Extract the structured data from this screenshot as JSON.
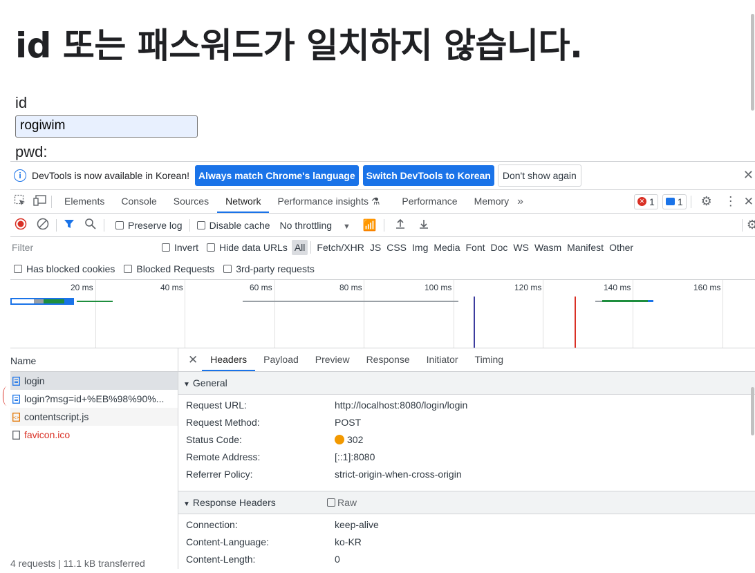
{
  "page": {
    "heading": "id 또는 패스워드가 일치하지 않습니다.",
    "id_label": "id",
    "id_value": "rogiwim",
    "pwd_label": "pwd:"
  },
  "infobar": {
    "message": "DevTools is now available in Korean!",
    "btn_match": "Always match Chrome's language",
    "btn_switch": "Switch DevTools to Korean",
    "btn_dont": "Don't show again"
  },
  "tabs": [
    "Elements",
    "Console",
    "Sources",
    "Network",
    "Performance insights",
    "Performance",
    "Memory"
  ],
  "active_tab": "Network",
  "badges": {
    "errors": "1",
    "messages": "1"
  },
  "toolbar": {
    "preserve_log": "Preserve log",
    "disable_cache": "Disable cache",
    "throttling": "No throttling"
  },
  "filter": {
    "placeholder": "Filter",
    "invert": "Invert",
    "hide_data_urls": "Hide data URLs",
    "types": [
      "All",
      "Fetch/XHR",
      "JS",
      "CSS",
      "Img",
      "Media",
      "Font",
      "Doc",
      "WS",
      "Wasm",
      "Manifest",
      "Other"
    ],
    "selected_type": "All"
  },
  "blocked": {
    "has_blocked_cookies": "Has blocked cookies",
    "blocked_requests": "Blocked Requests",
    "third_party": "3rd-party requests"
  },
  "timeline": {
    "ticks": [
      "20 ms",
      "40 ms",
      "60 ms",
      "80 ms",
      "100 ms",
      "120 ms",
      "140 ms",
      "160 ms"
    ]
  },
  "requests": {
    "header": "Name",
    "items": [
      {
        "name": "login",
        "type": "doc",
        "color": "#303942"
      },
      {
        "name": "login?msg=id+%EB%98%90%...",
        "type": "doc",
        "color": "#303942"
      },
      {
        "name": "contentscript.js",
        "type": "script",
        "color": "#303942"
      },
      {
        "name": "favicon.ico",
        "type": "other",
        "color": "#d93025"
      }
    ],
    "footer": "4 requests | 11.1 kB transferred"
  },
  "detail": {
    "tabs": [
      "Headers",
      "Payload",
      "Preview",
      "Response",
      "Initiator",
      "Timing"
    ],
    "active_tab": "Headers",
    "general_title": "General",
    "general": [
      {
        "k": "Request URL:",
        "v": "http://localhost:8080/login/login"
      },
      {
        "k": "Request Method:",
        "v": "POST"
      },
      {
        "k": "Status Code:",
        "v": "302"
      },
      {
        "k": "Remote Address:",
        "v": "[::1]:8080"
      },
      {
        "k": "Referrer Policy:",
        "v": "strict-origin-when-cross-origin"
      }
    ],
    "response_title": "Response Headers",
    "raw_label": "Raw",
    "response": [
      {
        "k": "Connection:",
        "v": "keep-alive"
      },
      {
        "k": "Content-Language:",
        "v": "ko-KR"
      },
      {
        "k": "Content-Length:",
        "v": "0"
      }
    ]
  },
  "colors": {
    "accent": "#1a73e8",
    "status_302": "#f29900",
    "error": "#d93025"
  }
}
